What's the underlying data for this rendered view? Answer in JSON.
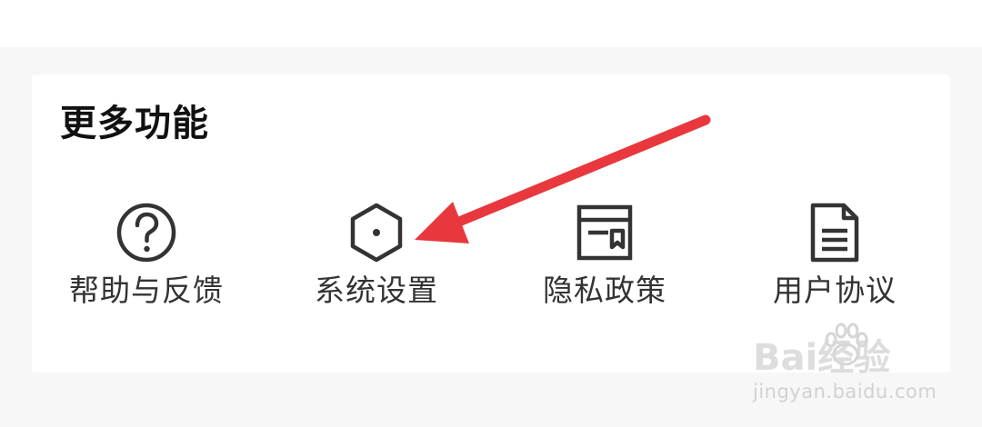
{
  "section": {
    "title": "更多功能"
  },
  "features": [
    {
      "label": "帮助与反馈",
      "icon": "help-circle-icon"
    },
    {
      "label": "系统设置",
      "icon": "settings-hexagon-icon"
    },
    {
      "label": "隐私政策",
      "icon": "privacy-policy-icon"
    },
    {
      "label": "用户协议",
      "icon": "user-agreement-document-icon"
    }
  ],
  "annotation": {
    "arrow_color": "#e8383d",
    "target": "系统设置"
  },
  "watermark": {
    "brand": "Bai经验",
    "url": "jingyan.baidu.com"
  },
  "colors": {
    "background": "#f7f7f7",
    "card": "#ffffff",
    "title_text": "#111111",
    "label_text": "#333333",
    "icon_stroke": "#333333"
  }
}
